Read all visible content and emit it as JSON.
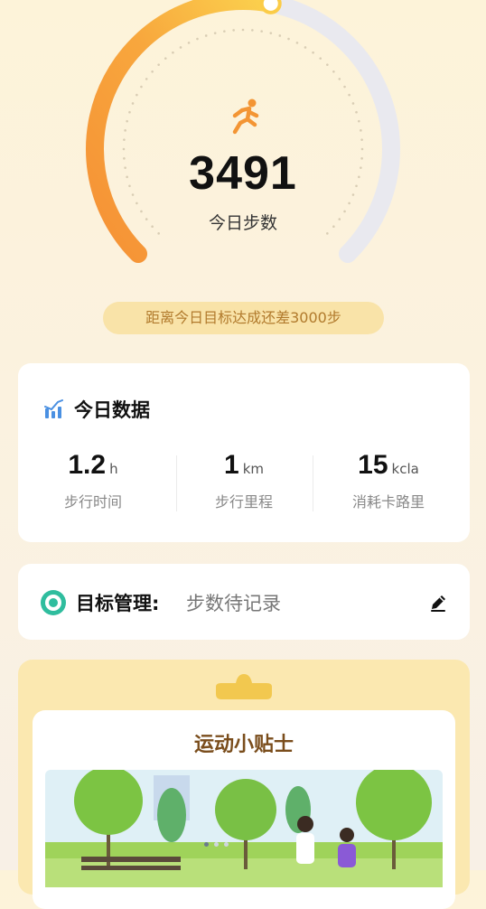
{
  "steps": {
    "value": "3491",
    "label": "今日步数",
    "progress_fraction": 0.54,
    "goal_remaining_text": "距离今日目标达成还差3000步"
  },
  "colors": {
    "accent_orange": "#f6943a",
    "accent_yellow": "#fbc84c",
    "goal_pill_bg": "#f9e3a8",
    "goal_pill_text": "#b17a2c",
    "target_icon": "#2fbd9e"
  },
  "today": {
    "title": "今日数据",
    "stats": [
      {
        "value": "1.2",
        "unit": "h",
        "label": "步行时间"
      },
      {
        "value": "1",
        "unit": "km",
        "label": "步行里程"
      },
      {
        "value": "15",
        "unit": "kcla",
        "label": "消耗卡路里"
      }
    ]
  },
  "target": {
    "label": "目标管理:",
    "value": "步数待记录"
  },
  "tips": {
    "title": "运动小贴士"
  },
  "icons": {
    "runner": "running-person-icon",
    "chart": "bar-chart-icon",
    "target": "target-circle-icon",
    "edit": "pencil-edit-icon"
  }
}
